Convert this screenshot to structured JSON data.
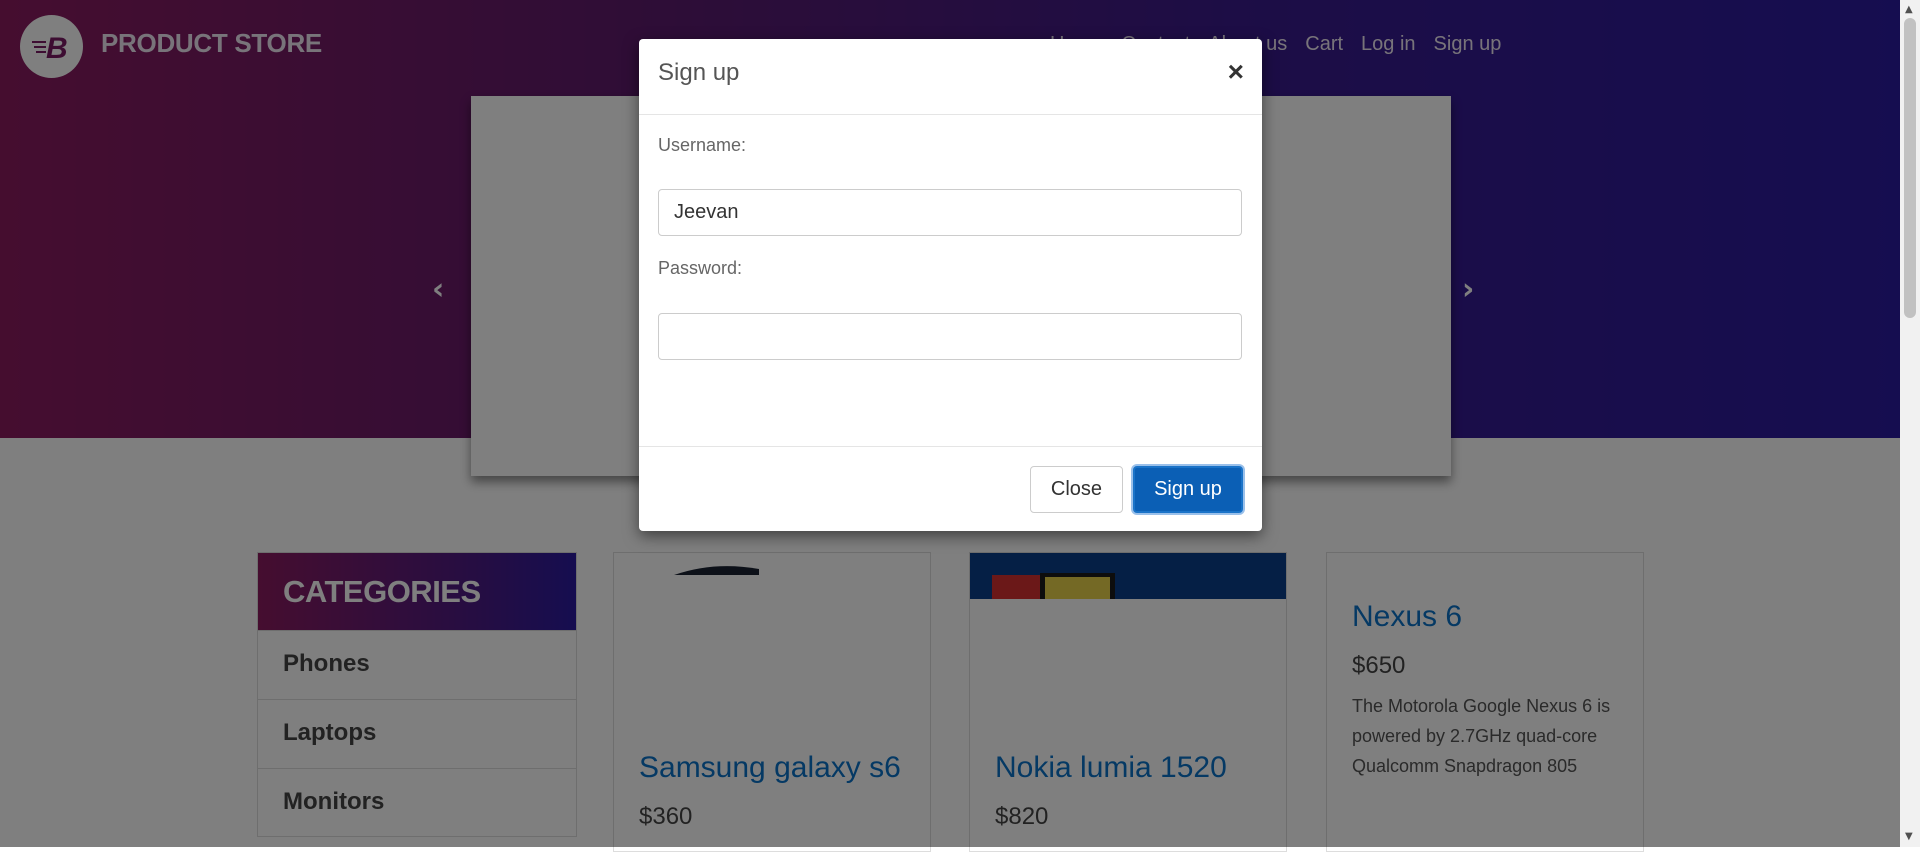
{
  "header": {
    "brand": "PRODUCT STORE",
    "nav": [
      "Home",
      "Contact",
      "About us",
      "Cart",
      "Log in",
      "Sign up"
    ]
  },
  "carousel": {
    "prev_icon": "chevron-left",
    "next_icon": "chevron-right"
  },
  "sidebar": {
    "title": "CATEGORIES",
    "items": [
      "Phones",
      "Laptops",
      "Monitors"
    ]
  },
  "products": [
    {
      "title": "Samsung galaxy s6",
      "price": "$360"
    },
    {
      "title": "Nokia lumia 1520",
      "price": "$820"
    },
    {
      "title": "Nexus 6",
      "price": "$650",
      "description": "The Motorola Google Nexus 6 is powered by 2.7GHz quad-core Qualcomm Snapdragon 805"
    }
  ],
  "modal": {
    "title": "Sign up",
    "close_icon": "×",
    "username_label": "Username:",
    "username_value": "Jeevan",
    "password_label": "Password:",
    "password_value": "",
    "close_button": "Close",
    "submit_button": "Sign up"
  },
  "colors": {
    "header_gradient_start": "#8b1a5f",
    "header_gradient_end": "#2b1aa0",
    "link_blue": "#0a72c8",
    "primary_button": "#0b5fb5"
  }
}
